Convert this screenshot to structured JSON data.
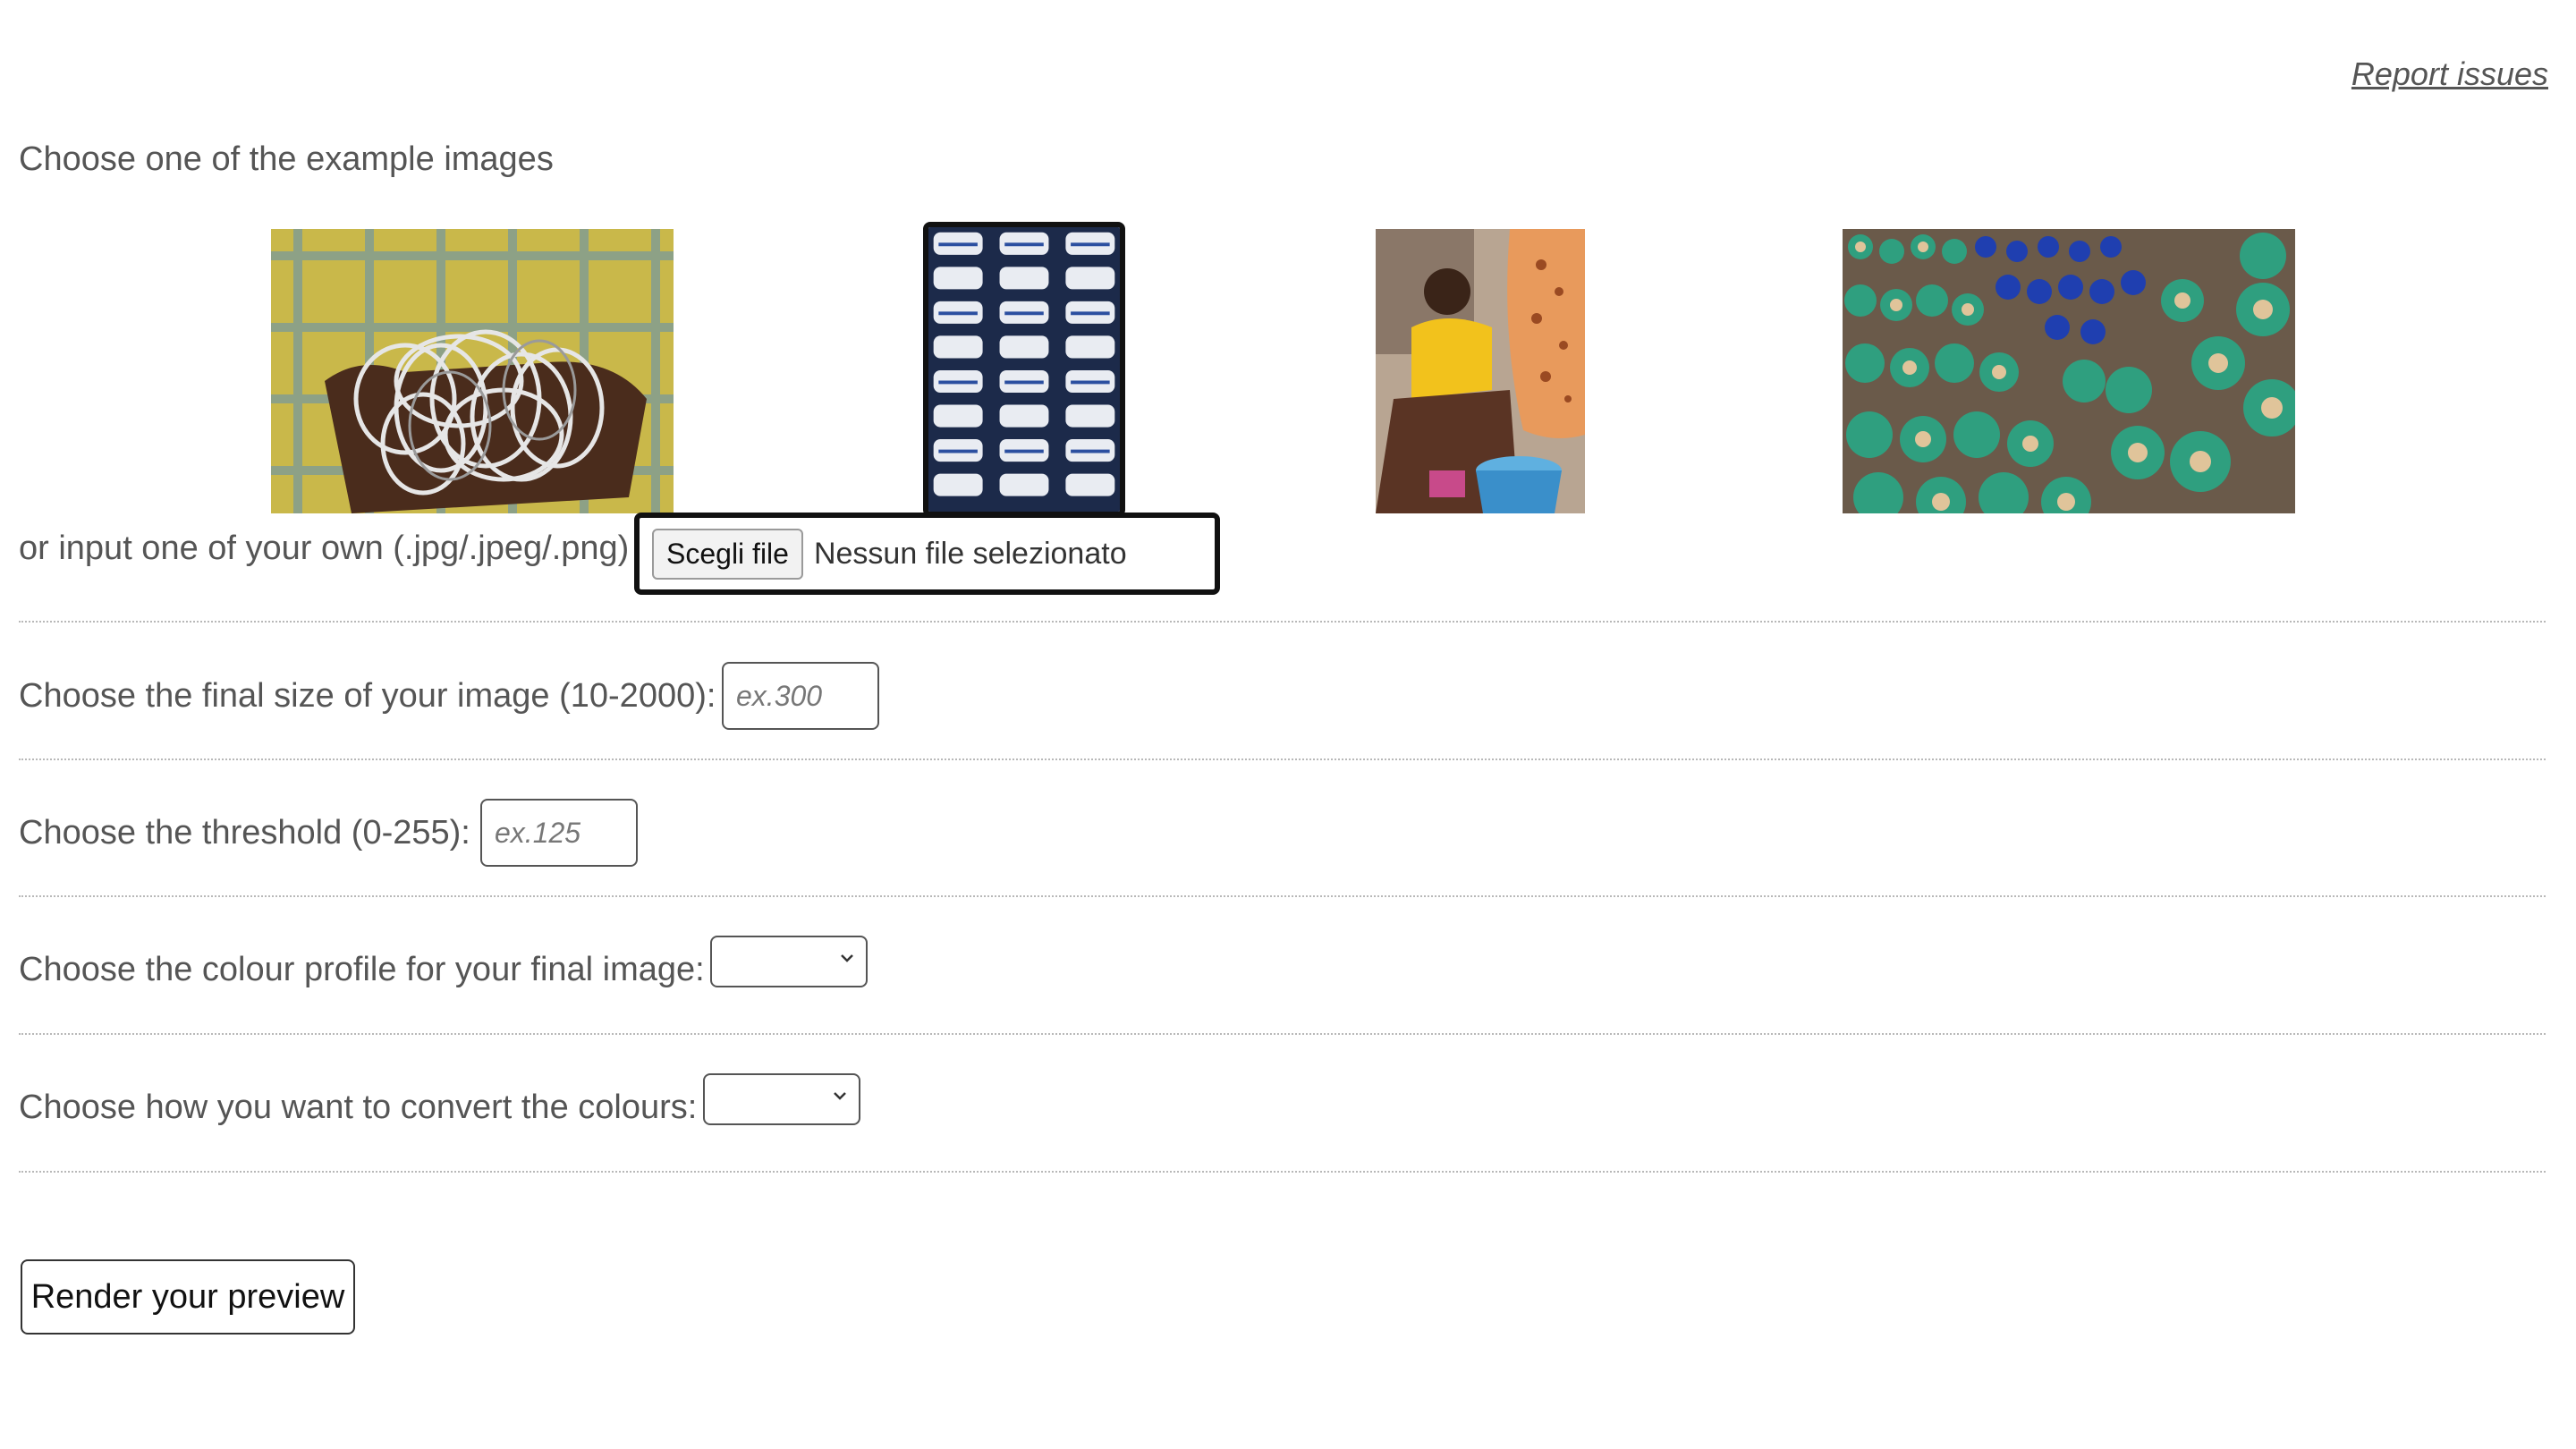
{
  "header": {
    "report_issues": "Report issues"
  },
  "examples": {
    "title": "Choose one of the example images",
    "images": [
      {
        "name": "silver-bangles-image",
        "selected": false
      },
      {
        "name": "ceramic-cups-image",
        "selected": true
      },
      {
        "name": "potter-woman-image",
        "selected": false
      },
      {
        "name": "green-pots-image",
        "selected": false
      }
    ]
  },
  "upload": {
    "label": "or input one of your own (.jpg/.jpeg/.png)",
    "button_label": "Scegli file",
    "status": "Nessun file selezionato"
  },
  "size_field": {
    "label": "Choose the final size of your image (10-2000):",
    "placeholder": "ex.300"
  },
  "threshold_field": {
    "label": "Choose the threshold (0-255):",
    "placeholder": "ex.125"
  },
  "colour_profile": {
    "label": "Choose the colour profile for your final image:",
    "value": ""
  },
  "convert_colours": {
    "label": "Choose how you want to convert the colours:",
    "value": ""
  },
  "render_button": {
    "label": "Render your preview"
  }
}
